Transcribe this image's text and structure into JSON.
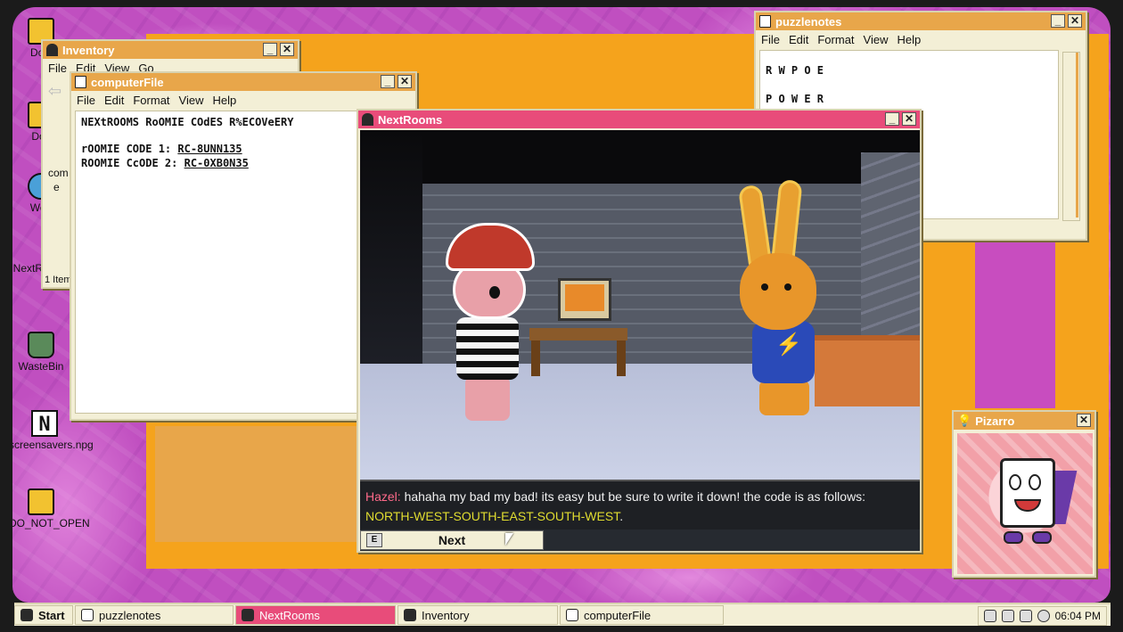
{
  "desktop_icons": [
    {
      "label": "Dow",
      "icon": "folder-icon"
    },
    {
      "label": "Doc",
      "icon": "folder-icon"
    },
    {
      "label": "Web",
      "icon": "globe-icon"
    },
    {
      "label": "NextRooms",
      "icon": "nextrooms-icon"
    },
    {
      "label": "WasteBin",
      "icon": "waste-bin-icon"
    },
    {
      "label": "screensavers.npg",
      "icon": "note-file-icon"
    },
    {
      "label": "DO_NOT_OPEN",
      "icon": "folder-icon"
    }
  ],
  "inventory": {
    "title": "Inventory",
    "menu": [
      "File",
      "Edit",
      "View",
      "Go"
    ],
    "partial_items": [
      "com",
      "e"
    ],
    "status": "1 Item("
  },
  "computerfile": {
    "title": "computerFile",
    "menu": [
      "File",
      "Edit",
      "Format",
      "View",
      "Help"
    ],
    "heading": "NEXtROOMS RoOMIE COdES R%ECOVeERY",
    "line1_label": "rOOMIE CODE 1: ",
    "line1_code": "RC-8UNN135",
    "line2_label": "ROOMIE CcODE 2: ",
    "line2_code": "RC-0XB0N35"
  },
  "puzzlenotes": {
    "title": "puzzlenotes",
    "menu": [
      "File",
      "Edit",
      "Format",
      "View",
      "Help"
    ],
    "line1": "R W P O E",
    "line2": "P O W E R"
  },
  "nextrooms": {
    "title": "NextRooms",
    "dialog_speaker": "Hazel:",
    "dialog_text": " hahaha my bad my bad! its easy but be sure to write it down! the code is as follows: ",
    "dialog_code": "NORTH-WEST-SOUTH-EAST-SOUTH-WEST",
    "dialog_end": ".",
    "key_hint": "E",
    "next_label": "Next"
  },
  "pizarro": {
    "title": "Pizarro"
  },
  "taskbar": {
    "start_label": "Start",
    "items": [
      {
        "label": "puzzlenotes",
        "active": false
      },
      {
        "label": "NextRooms",
        "active": true
      },
      {
        "label": "Inventory",
        "active": false
      },
      {
        "label": "computerFile",
        "active": false
      }
    ],
    "clock": "06:04 PM"
  },
  "colors": {
    "desktop_bg": "#c04fc0",
    "title_inactive": "#e8a64a",
    "title_active": "#e84c7a",
    "window_bg": "#f3efd6",
    "dialog_code": "#e0dc30",
    "dialog_speaker": "#ff6a8a"
  }
}
